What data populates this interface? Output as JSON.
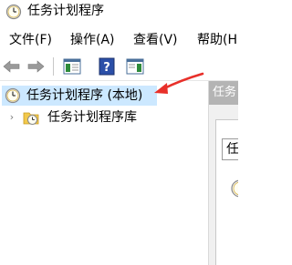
{
  "window": {
    "title": "任务计划程序"
  },
  "menu": {
    "file": "文件(F)",
    "action": "操作(A)",
    "view": "查看(V)",
    "help": "帮助(H"
  },
  "toolbar": {
    "icons": [
      "back-arrow-icon",
      "forward-arrow-icon",
      "show-hide-tree-icon",
      "help-icon",
      "show-hide-action-pane-icon"
    ]
  },
  "tree": {
    "root_label": "任务计划程序 (本地)",
    "child_label": "任务计划程序库"
  },
  "right_pane": {
    "header_text": "任务",
    "box_label": "任"
  },
  "colors": {
    "selection": "#cce8ff",
    "annotation_arrow": "#e8302a",
    "right_header": "#b4b4b4"
  }
}
